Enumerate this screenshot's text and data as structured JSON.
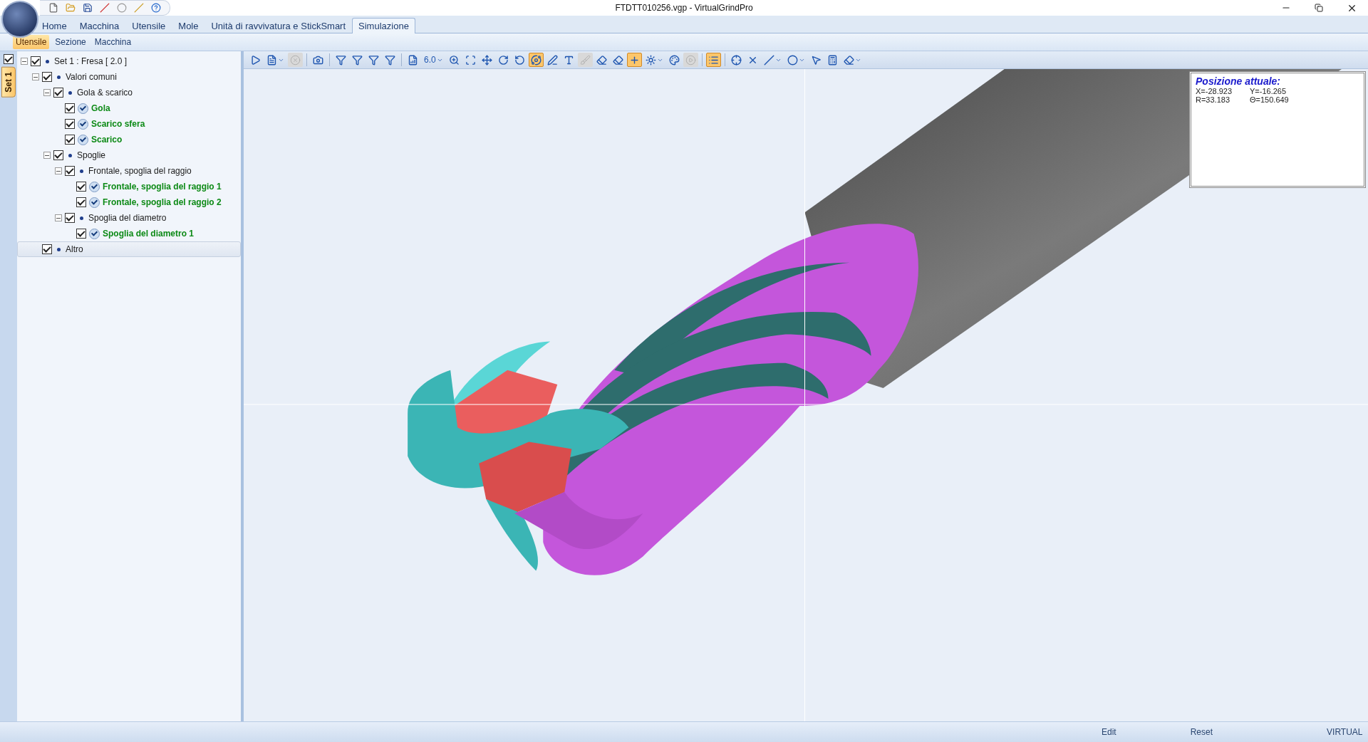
{
  "window": {
    "title": "FTDTT010256.vgp - VirtualGrindPro"
  },
  "ribbon_tabs": [
    {
      "label": "Home",
      "selected": false
    },
    {
      "label": "Macchina",
      "selected": false
    },
    {
      "label": "Utensile",
      "selected": false
    },
    {
      "label": "Mole",
      "selected": false
    },
    {
      "label": "Unità di ravvivatura e StickSmart",
      "selected": false
    },
    {
      "label": "Simulazione",
      "selected": true
    }
  ],
  "sub_tabs": [
    {
      "label": "Utensile",
      "selected": true
    },
    {
      "label": "Sezione",
      "selected": false
    },
    {
      "label": "Macchina",
      "selected": false
    }
  ],
  "side_strip": {
    "checked": true,
    "tabs": [
      {
        "label": "Set 1",
        "selected": true
      }
    ]
  },
  "tree": [
    {
      "kind": "group",
      "label": "Set 1 : Fresa [ 2.0 ]",
      "checked": true,
      "expanded": true,
      "selected": false,
      "children": [
        {
          "kind": "group",
          "label": "Valori comuni",
          "checked": true,
          "expanded": true,
          "selected": false,
          "children": [
            {
              "kind": "group",
              "label": "Gola & scarico",
              "checked": true,
              "expanded": true,
              "selected": false,
              "children": [
                {
                  "kind": "item",
                  "label": "Gola",
                  "checked": true,
                  "selected": false
                },
                {
                  "kind": "item",
                  "label": "Scarico sfera",
                  "checked": true,
                  "selected": false
                },
                {
                  "kind": "item",
                  "label": "Scarico",
                  "checked": true,
                  "selected": false
                }
              ]
            },
            {
              "kind": "group",
              "label": "Spoglie",
              "checked": true,
              "expanded": true,
              "selected": false,
              "children": [
                {
                  "kind": "group",
                  "label": "Frontale, spoglia del raggio",
                  "checked": true,
                  "expanded": true,
                  "selected": false,
                  "children": [
                    {
                      "kind": "item",
                      "label": "Frontale, spoglia del raggio 1",
                      "checked": true,
                      "selected": false
                    },
                    {
                      "kind": "item",
                      "label": "Frontale, spoglia del raggio 2",
                      "checked": true,
                      "selected": false
                    }
                  ]
                },
                {
                  "kind": "group",
                  "label": "Spoglia del diametro",
                  "checked": true,
                  "expanded": true,
                  "selected": false,
                  "children": [
                    {
                      "kind": "item",
                      "label": "Spoglia del diametro 1",
                      "checked": true,
                      "selected": false
                    }
                  ]
                }
              ]
            }
          ]
        },
        {
          "kind": "group",
          "label": "Altro",
          "checked": true,
          "selected": true
        }
      ]
    }
  ],
  "toolbar": [
    {
      "kind": "icon",
      "pressed": false,
      "disabled": false,
      "dropdown": false
    },
    {
      "kind": "icon",
      "pressed": false,
      "disabled": false,
      "dropdown": true
    },
    {
      "kind": "icon",
      "pressed": false,
      "disabled": true,
      "dropdown": false
    },
    {
      "kind": "separator"
    },
    {
      "kind": "icon",
      "pressed": false,
      "disabled": false,
      "dropdown": false
    },
    {
      "kind": "separator"
    },
    {
      "kind": "icon",
      "pressed": false,
      "disabled": false,
      "dropdown": false
    },
    {
      "kind": "icon",
      "pressed": false,
      "disabled": false,
      "dropdown": false
    },
    {
      "kind": "icon",
      "pressed": false,
      "disabled": false,
      "dropdown": false
    },
    {
      "kind": "icon",
      "pressed": false,
      "disabled": false,
      "dropdown": false
    },
    {
      "kind": "separator"
    },
    {
      "kind": "icon",
      "pressed": false,
      "disabled": false,
      "dropdown": false
    },
    {
      "kind": "value",
      "label": "6.0",
      "dropdown": true
    },
    {
      "kind": "icon",
      "pressed": false,
      "disabled": false,
      "dropdown": false
    },
    {
      "kind": "icon",
      "pressed": false,
      "disabled": false,
      "dropdown": false
    },
    {
      "kind": "icon",
      "pressed": false,
      "disabled": false,
      "dropdown": false
    },
    {
      "kind": "icon",
      "pressed": false,
      "disabled": false,
      "dropdown": false
    },
    {
      "kind": "icon",
      "pressed": false,
      "disabled": false,
      "dropdown": false
    },
    {
      "kind": "icon",
      "pressed": true,
      "disabled": false,
      "dropdown": false
    },
    {
      "kind": "icon",
      "pressed": false,
      "disabled": false,
      "dropdown": false
    },
    {
      "kind": "icon",
      "pressed": false,
      "disabled": false,
      "dropdown": false
    },
    {
      "kind": "icon",
      "pressed": false,
      "disabled": true,
      "dropdown": false
    },
    {
      "kind": "icon",
      "pressed": false,
      "disabled": false,
      "dropdown": false
    },
    {
      "kind": "icon",
      "pressed": false,
      "disabled": false,
      "dropdown": false
    },
    {
      "kind": "icon",
      "pressed": true,
      "disabled": false,
      "dropdown": false
    },
    {
      "kind": "icon",
      "pressed": false,
      "disabled": false,
      "dropdown": true
    },
    {
      "kind": "icon",
      "pressed": false,
      "disabled": false,
      "dropdown": false
    },
    {
      "kind": "icon",
      "pressed": false,
      "disabled": true,
      "dropdown": false
    },
    {
      "kind": "separator"
    },
    {
      "kind": "icon",
      "pressed": true,
      "disabled": false,
      "dropdown": false
    },
    {
      "kind": "separator"
    },
    {
      "kind": "icon",
      "pressed": false,
      "disabled": false,
      "dropdown": false
    },
    {
      "kind": "icon",
      "pressed": false,
      "disabled": false,
      "dropdown": false
    },
    {
      "kind": "icon",
      "pressed": false,
      "disabled": false,
      "dropdown": true
    },
    {
      "kind": "icon",
      "pressed": false,
      "disabled": false,
      "dropdown": true
    },
    {
      "kind": "icon",
      "pressed": false,
      "disabled": false,
      "dropdown": false
    },
    {
      "kind": "icon",
      "pressed": false,
      "disabled": false,
      "dropdown": false
    },
    {
      "kind": "icon",
      "pressed": false,
      "disabled": false,
      "dropdown": true
    }
  ],
  "position_panel": {
    "title": "Posizione attuale:",
    "readouts": [
      "X=-28.923",
      "Y=-16.265",
      "R=33.183",
      "Θ=150.649"
    ]
  },
  "status_bar": [
    "Edit",
    "Reset",
    "VIRTUAL"
  ]
}
